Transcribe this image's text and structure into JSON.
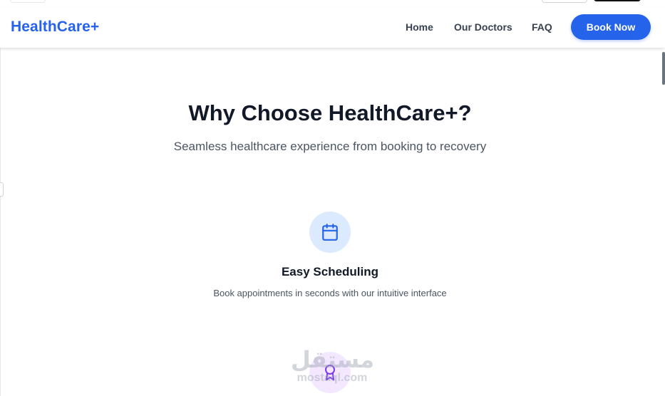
{
  "navbar": {
    "brand": "HealthCare+",
    "links": [
      "Home",
      "Our Doctors",
      "FAQ"
    ],
    "cta": "Book Now"
  },
  "section": {
    "title": "Why Choose HealthCare+?",
    "subtitle": "Seamless healthcare experience from booking to recovery"
  },
  "features": [
    {
      "icon": "calendar-icon",
      "title": "Easy Scheduling",
      "description": "Book appointments in seconds with our intuitive interface",
      "color": "#2563eb",
      "bg": "#dbeafe"
    },
    {
      "icon": "award-icon",
      "color": "#7c3aed",
      "bg": "#f3e8ff"
    }
  ],
  "watermark": {
    "arabic": "مستقل",
    "latin": "mostaql.com"
  },
  "colors": {
    "primary": "#2563eb",
    "text_dark": "#111827",
    "text_muted": "#4b5563"
  }
}
